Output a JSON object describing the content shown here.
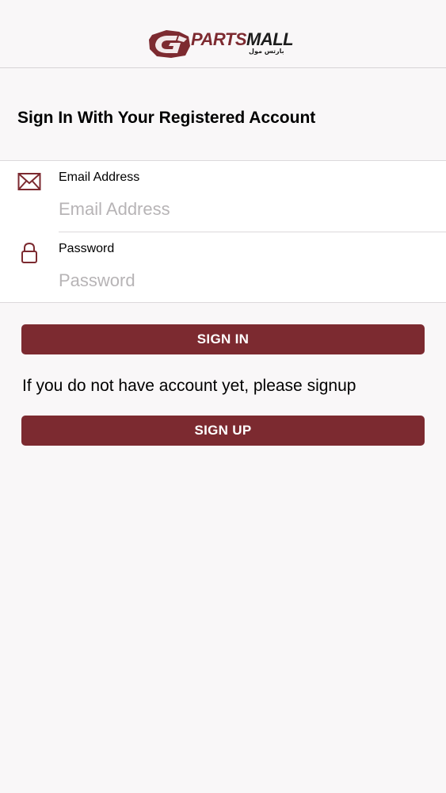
{
  "header": {
    "logo": {
      "brand_part1": "PARTS",
      "brand_part2": "MALL",
      "brand_arabic": "بارتس مول"
    }
  },
  "main": {
    "title": "Sign In With Your Registered Account",
    "form": {
      "email": {
        "label": "Email Address",
        "placeholder": "Email Address",
        "value": "",
        "icon": "envelope-icon"
      },
      "password": {
        "label": "Password",
        "placeholder": "Password",
        "value": "",
        "icon": "lock-icon"
      }
    },
    "signin_label": "SIGN IN",
    "signup_prompt": "If you do not have account yet, please signup",
    "signup_label": "SIGN UP"
  },
  "colors": {
    "accent": "#7c2a30",
    "background": "#f9f7f8",
    "placeholder": "#b7b4b6",
    "divider": "#dcd9db"
  }
}
